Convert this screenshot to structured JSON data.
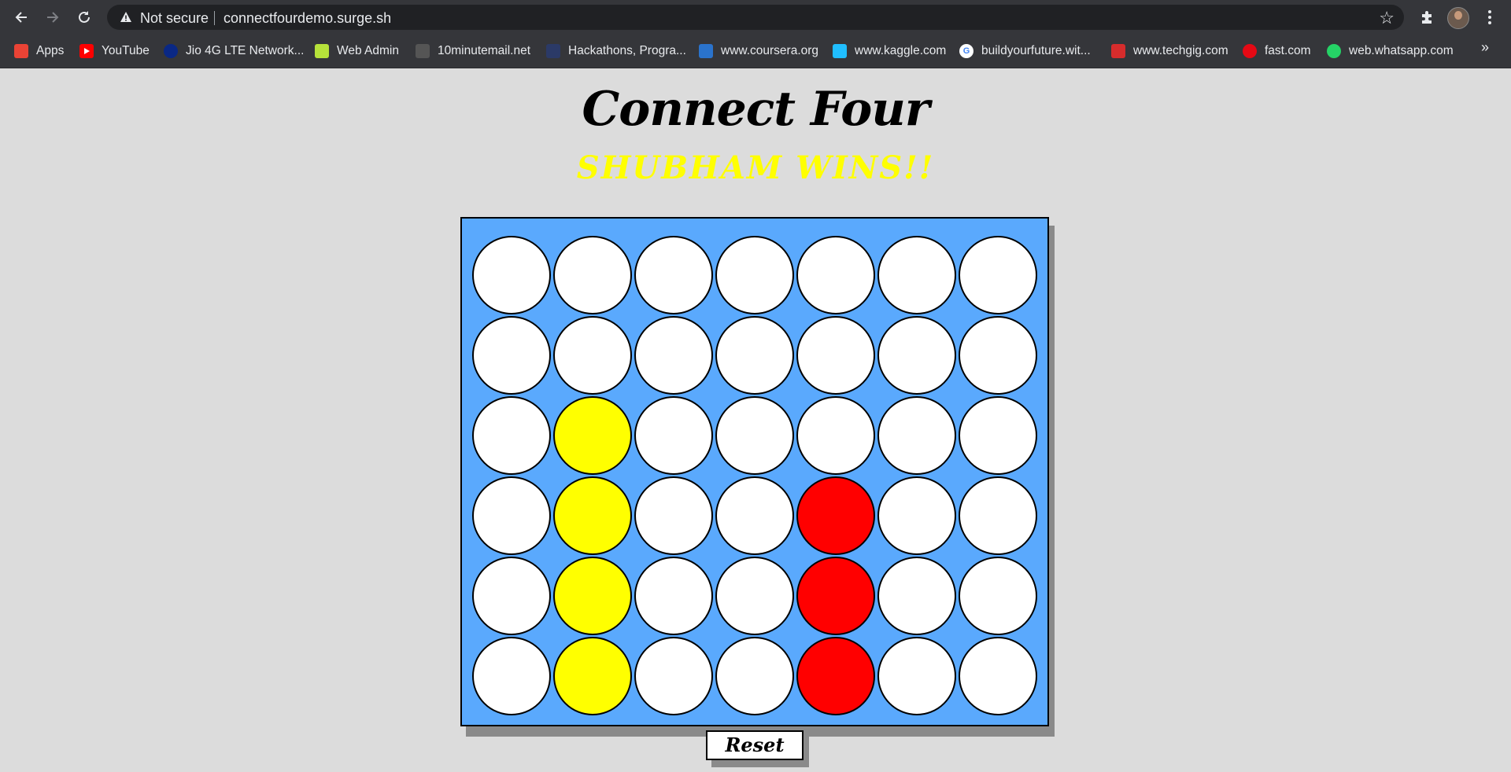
{
  "browser": {
    "security_label": "Not secure",
    "url": "connectfourdemo.surge.sh",
    "icons": [
      "back-icon",
      "forward-icon",
      "reload-icon",
      "warning-icon",
      "star-icon",
      "extensions-icon",
      "menu-icon"
    ]
  },
  "bookmarks": [
    {
      "label": "Apps",
      "icon": "apps-grid-icon",
      "color": "#ea4335"
    },
    {
      "label": "YouTube",
      "icon": "youtube-icon",
      "color": "#ff0000"
    },
    {
      "label": "Jio 4G LTE Network...",
      "icon": "jio-icon",
      "color": "#0a2885"
    },
    {
      "label": "Web Admin",
      "icon": "lte-icon",
      "color": "#b6e23a"
    },
    {
      "label": "10minutemail.net",
      "icon": "ten-icon",
      "color": "#555555"
    },
    {
      "label": "Hackathons, Progra...",
      "icon": "hackathon-icon",
      "color": "#2b3a67"
    },
    {
      "label": "www.coursera.org",
      "icon": "coursera-icon",
      "color": "#2a73cc"
    },
    {
      "label": "www.kaggle.com",
      "icon": "kaggle-icon",
      "color": "#20beff"
    },
    {
      "label": "buildyourfuture.wit...",
      "icon": "google-icon",
      "color": "#ffffff"
    },
    {
      "label": "www.techgig.com",
      "icon": "techgig-icon",
      "color": "#d62c2c"
    },
    {
      "label": "fast.com",
      "icon": "fast-icon",
      "color": "#e50914"
    },
    {
      "label": "web.whatsapp.com",
      "icon": "whatsapp-icon",
      "color": "#25d366"
    }
  ],
  "bookmarks_overflow": "»",
  "game": {
    "title": "Connect Four",
    "status": "SHUBHAM WINS!!",
    "reset_label": "Reset",
    "colors": {
      "board": "#5aa9fd",
      "empty": "#ffffff",
      "yellow": "#ffff00",
      "red": "#ff0000",
      "status": "#ffff00"
    },
    "rows": 6,
    "cols": 7,
    "grid": [
      [
        "empty",
        "empty",
        "empty",
        "empty",
        "empty",
        "empty",
        "empty"
      ],
      [
        "empty",
        "empty",
        "empty",
        "empty",
        "empty",
        "empty",
        "empty"
      ],
      [
        "empty",
        "yellow",
        "empty",
        "empty",
        "empty",
        "empty",
        "empty"
      ],
      [
        "empty",
        "yellow",
        "empty",
        "empty",
        "red",
        "empty",
        "empty"
      ],
      [
        "empty",
        "yellow",
        "empty",
        "empty",
        "red",
        "empty",
        "empty"
      ],
      [
        "empty",
        "yellow",
        "empty",
        "empty",
        "red",
        "empty",
        "empty"
      ]
    ]
  }
}
